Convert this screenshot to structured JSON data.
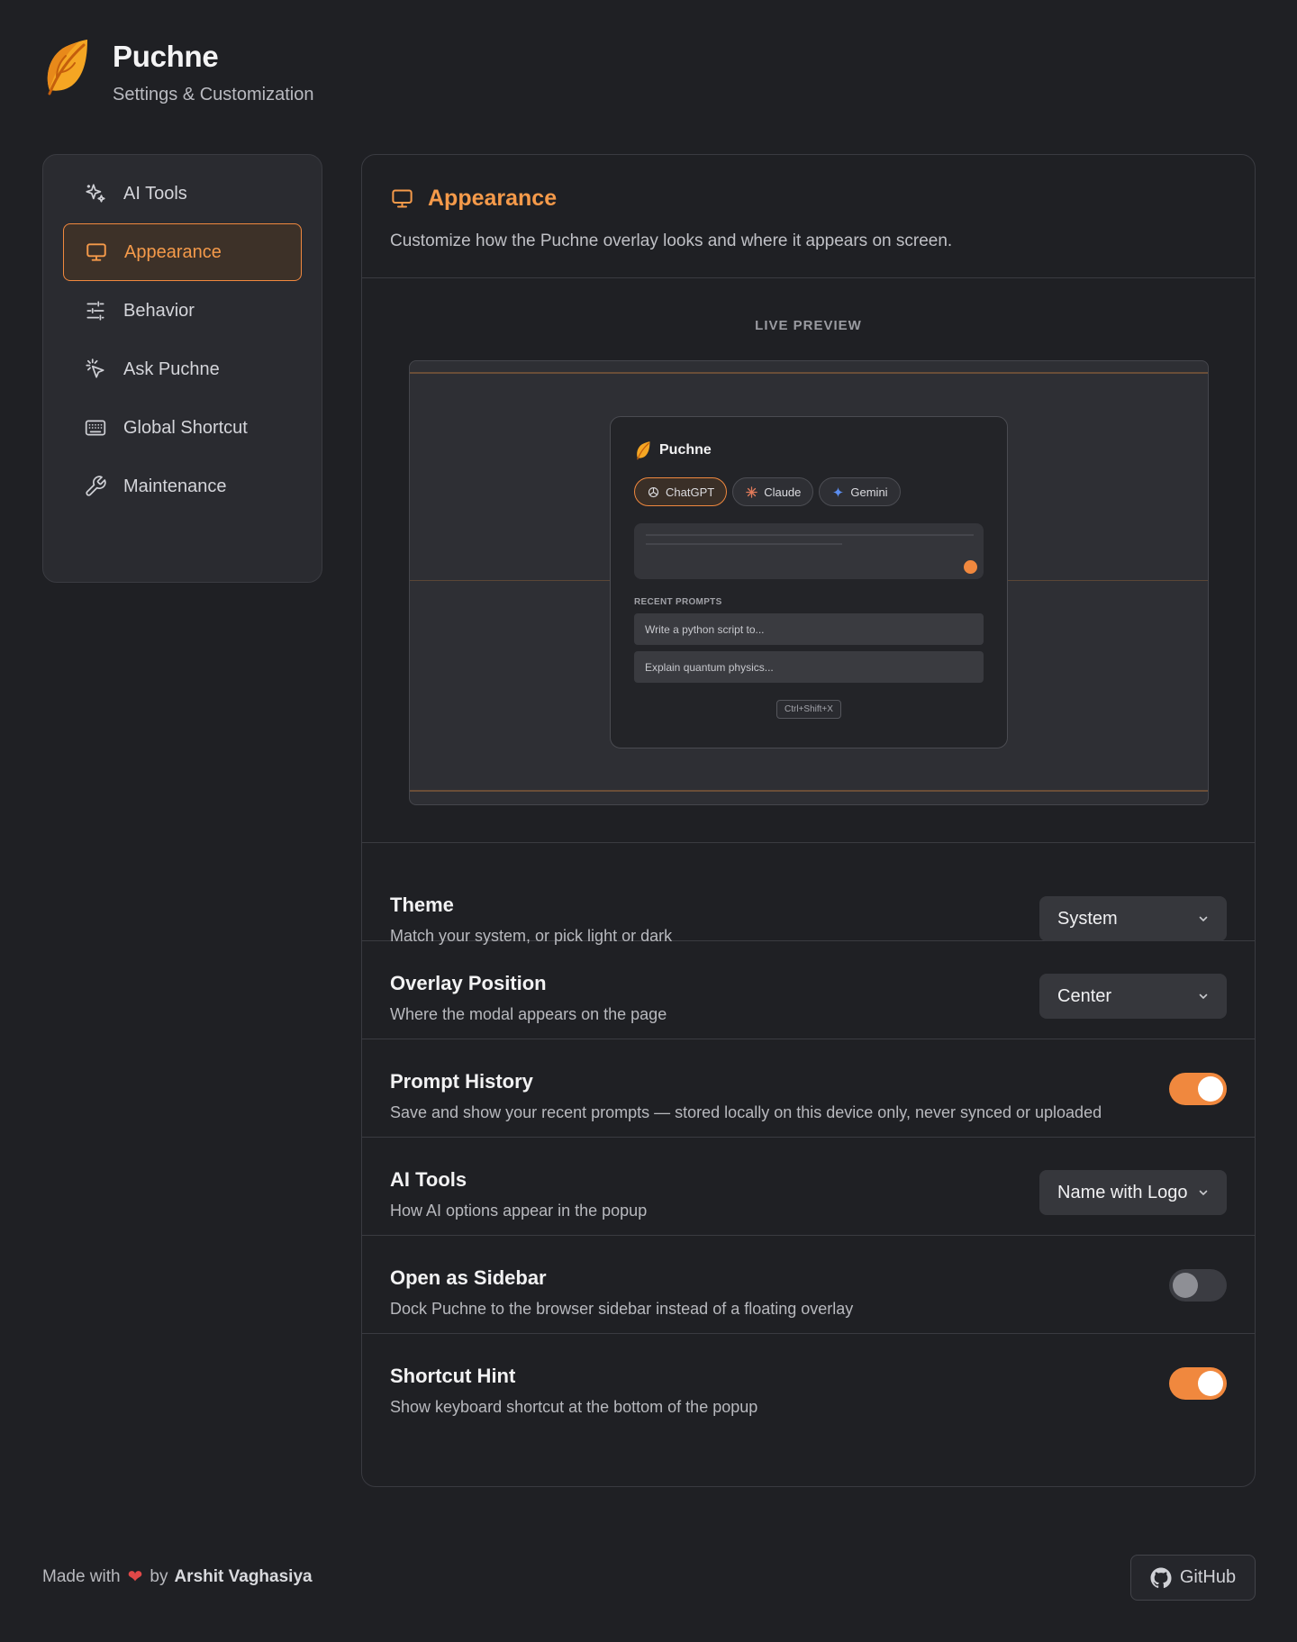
{
  "app": {
    "title": "Puchne",
    "subtitle": "Settings & Customization"
  },
  "sidebar": {
    "items": [
      {
        "label": "AI Tools",
        "icon": "sparkles-icon"
      },
      {
        "label": "Appearance",
        "icon": "monitor-icon",
        "active": true
      },
      {
        "label": "Behavior",
        "icon": "sliders-icon"
      },
      {
        "label": "Ask Puchne",
        "icon": "cursor-sparkle-icon"
      },
      {
        "label": "Global Shortcut",
        "icon": "keyboard-icon"
      },
      {
        "label": "Maintenance",
        "icon": "wrench-icon"
      }
    ]
  },
  "main": {
    "title": "Appearance",
    "description": "Customize how the Puchne overlay looks and where it appears on screen."
  },
  "preview": {
    "label": "LIVE PREVIEW",
    "popup_title": "Puchne",
    "chips": [
      "ChatGPT",
      "Claude",
      "Gemini"
    ],
    "recent_label": "RECENT PROMPTS",
    "recent": [
      "Write a python script to...",
      "Explain quantum physics..."
    ],
    "shortcut": "Ctrl+Shift+X"
  },
  "settings": {
    "theme": {
      "title": "Theme",
      "desc": "Match your system, or pick light or dark",
      "value": "System"
    },
    "position": {
      "title": "Overlay Position",
      "desc": "Where the modal appears on the page",
      "value": "Center"
    },
    "history": {
      "title": "Prompt History",
      "desc": "Save and show your recent prompts — stored locally on this device only, never synced or uploaded",
      "enabled": true
    },
    "ai_tools": {
      "title": "AI Tools",
      "desc": "How AI options appear in the popup",
      "value": "Name with Logo"
    },
    "sidebar_mode": {
      "title": "Open as Sidebar",
      "desc": "Dock Puchne to the browser sidebar instead of a floating overlay",
      "enabled": false
    },
    "shortcut_hint": {
      "title": "Shortcut Hint",
      "desc": "Show keyboard shortcut at the bottom of the popup",
      "enabled": true
    }
  },
  "footer": {
    "made_with": "Made with",
    "by": "by",
    "author": "Arshit Vaghasiya",
    "github": "GitHub"
  },
  "colors": {
    "accent": "#f0883e",
    "background": "#1f2024",
    "panel": "#2a2b30"
  }
}
